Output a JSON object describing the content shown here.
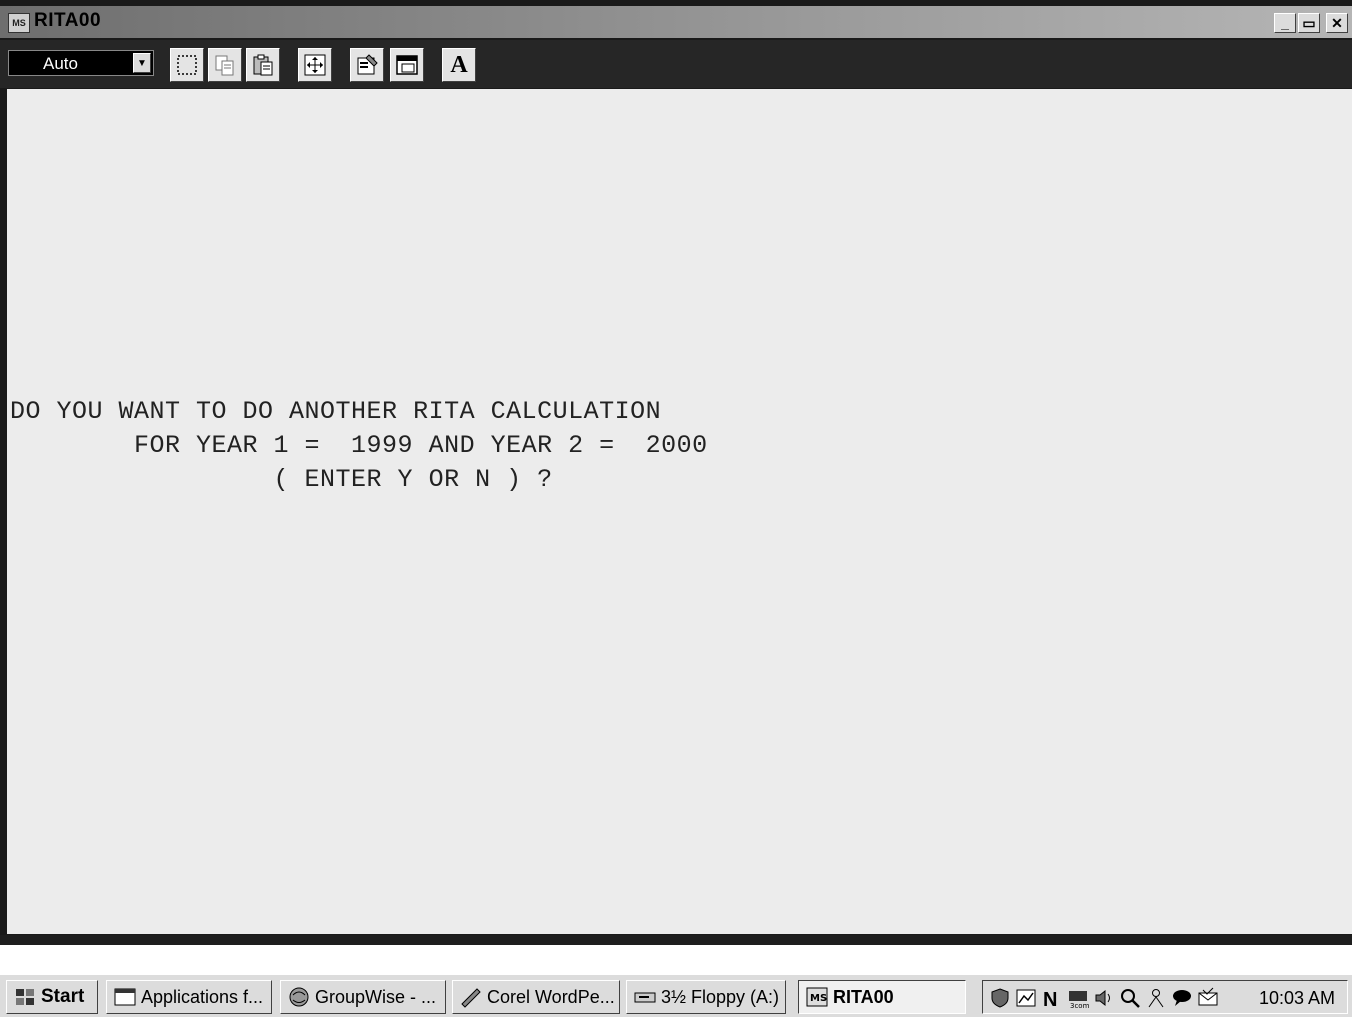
{
  "window": {
    "title": "RITA00",
    "icon_text": "MS",
    "controls": {
      "minimize": "_",
      "maximize": "▭",
      "close": "✕"
    }
  },
  "toolbar": {
    "font_size_value": "Auto",
    "buttons": [
      "mark-icon",
      "copy-icon",
      "paste-icon",
      "full-screen-icon",
      "properties-icon",
      "background-icon",
      "font-icon"
    ],
    "font_button_label": "A"
  },
  "console": {
    "lines": [
      "DO YOU WANT TO DO ANOTHER RITA CALCULATION",
      "        FOR YEAR 1 =  1999 AND YEAR 2 =  2000",
      "                 ( ENTER Y OR N ) ?"
    ]
  },
  "taskbar": {
    "start_label": "Start",
    "tasks": [
      {
        "label": "Applications f...",
        "icon": "window-icon"
      },
      {
        "label": "GroupWise - ...",
        "icon": "groupwise-icon"
      },
      {
        "label": "Corel WordPe...",
        "icon": "quill-icon"
      },
      {
        "label": "3½ Floppy (A:)",
        "icon": "floppy-drive-icon"
      },
      {
        "label": "RITA00",
        "icon": "msdos-icon",
        "active": true
      }
    ],
    "tray_icons": [
      "shield-icon",
      "chart-icon",
      "n-icon",
      "3com-network-icon",
      "speaker-icon",
      "search-icon",
      "person-icon",
      "chat-icon",
      "envelope-icon"
    ],
    "clock": "10:03 AM"
  }
}
